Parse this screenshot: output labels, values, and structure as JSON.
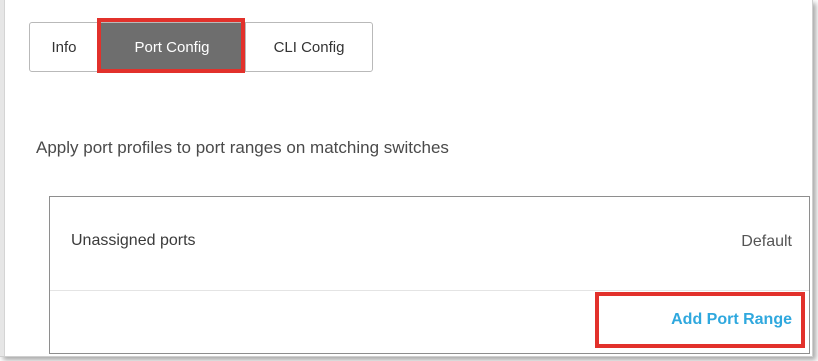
{
  "tabs": [
    {
      "label": "Info",
      "active": false
    },
    {
      "label": "Port Config",
      "active": true
    },
    {
      "label": "CLI Config",
      "active": false
    }
  ],
  "description": "Apply port profiles to port ranges on matching switches",
  "port_ranges": {
    "rows": [
      {
        "name": "Unassigned ports",
        "profile": "Default"
      }
    ],
    "add_label": "Add Port Range"
  },
  "colors": {
    "active_tab_bg": "#6e6e6e",
    "highlight": "#e2312b",
    "link": "#2fa8de"
  }
}
